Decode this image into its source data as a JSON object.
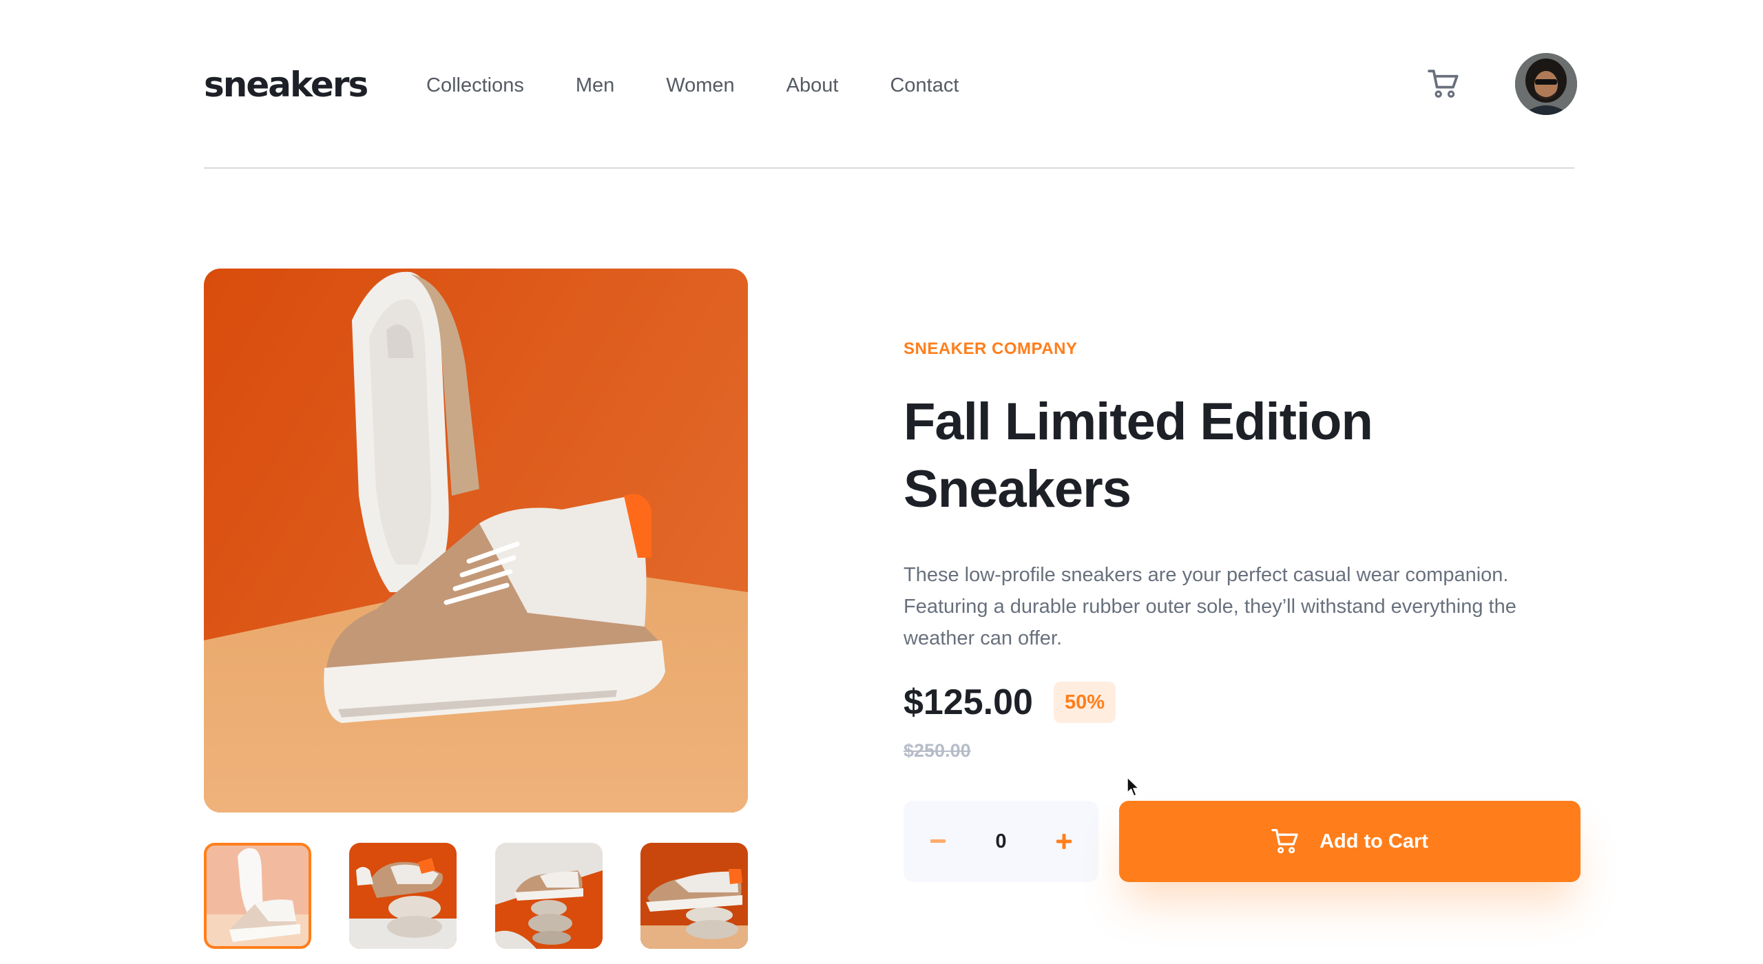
{
  "header": {
    "logo": "sneakers",
    "nav": [
      "Collections",
      "Men",
      "Women",
      "About",
      "Contact"
    ],
    "cart_icon": "cart-icon",
    "avatar_icon": "user-avatar"
  },
  "gallery": {
    "main_image": "sneaker-sole-and-side-photo-orange-background",
    "thumbnails": [
      "thumbnail-1-sneaker-sole-side",
      "thumbnail-2-sneaker-on-stones",
      "thumbnail-3-sneaker-balanced-on-rocks",
      "thumbnail-4-sneaker-side-on-stones"
    ],
    "active_thumbnail": 1
  },
  "product": {
    "company": "SNEAKER COMPANY",
    "title_line1": "Fall Limited Edition",
    "title_line2": "Sneakers",
    "description": "These low-profile sneakers are your perfect casual wear companion. Featuring a durable rubber outer sole, they’ll withstand everything the weather can offer.",
    "price": "$125.00",
    "discount": "50%",
    "old_price": "$250.00"
  },
  "cart_controls": {
    "minus": "−",
    "quantity": "0",
    "plus": "+",
    "add_to_cart": "Add to Cart",
    "add_icon": "cart-icon"
  },
  "colors": {
    "accent": "#ff7e1b",
    "accent_pale": "#ffede0",
    "dark": "#1d2026",
    "text_muted": "#68707d",
    "qty_bg": "#f6f8fd"
  }
}
